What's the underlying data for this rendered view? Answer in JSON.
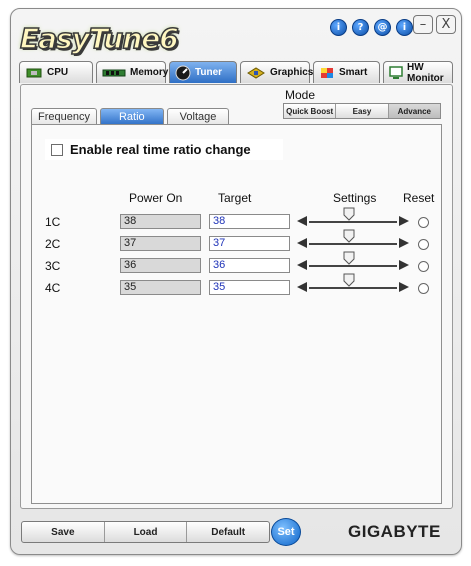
{
  "app": {
    "logo_text": "EasyTune6"
  },
  "title_icons": [
    "i",
    "?",
    "@",
    "i"
  ],
  "window_buttons": {
    "minimize": "–",
    "close": "X"
  },
  "main_tabs": [
    {
      "label": "CPU",
      "icon": "cpu-chip-icon"
    },
    {
      "label": "Memory",
      "icon": "memory-stick-icon"
    },
    {
      "label": "Tuner",
      "icon": "tuner-gauge-icon",
      "active": true
    },
    {
      "label": "Graphics",
      "icon": "graphics-card-icon"
    },
    {
      "label": "Smart",
      "icon": "smart-cube-icon"
    },
    {
      "label": "HW Monitor",
      "icon": "hw-monitor-icon"
    }
  ],
  "mode": {
    "label": "Mode",
    "options": [
      "Quick Boost",
      "Easy",
      "Advance"
    ],
    "selected": "Advance"
  },
  "sub_tabs": [
    {
      "label": "Frequency"
    },
    {
      "label": "Ratio",
      "active": true
    },
    {
      "label": "Voltage"
    }
  ],
  "enable_realtime": {
    "label": "Enable real time ratio change",
    "checked": false
  },
  "table": {
    "headers": {
      "power_on": "Power On",
      "target": "Target",
      "settings": "Settings",
      "reset": "Reset"
    },
    "rows": [
      {
        "label": "1C",
        "power_on": "38",
        "target": "38"
      },
      {
        "label": "2C",
        "power_on": "37",
        "target": "37"
      },
      {
        "label": "3C",
        "power_on": "36",
        "target": "36"
      },
      {
        "label": "4C",
        "power_on": "35",
        "target": "35"
      }
    ]
  },
  "bottom": {
    "save": "Save",
    "load": "Load",
    "default": "Default",
    "set": "Set",
    "brand": "GIGABYTE"
  },
  "colors": {
    "accent_blue": "#2e6fc6",
    "target_text": "#1f33b8"
  }
}
